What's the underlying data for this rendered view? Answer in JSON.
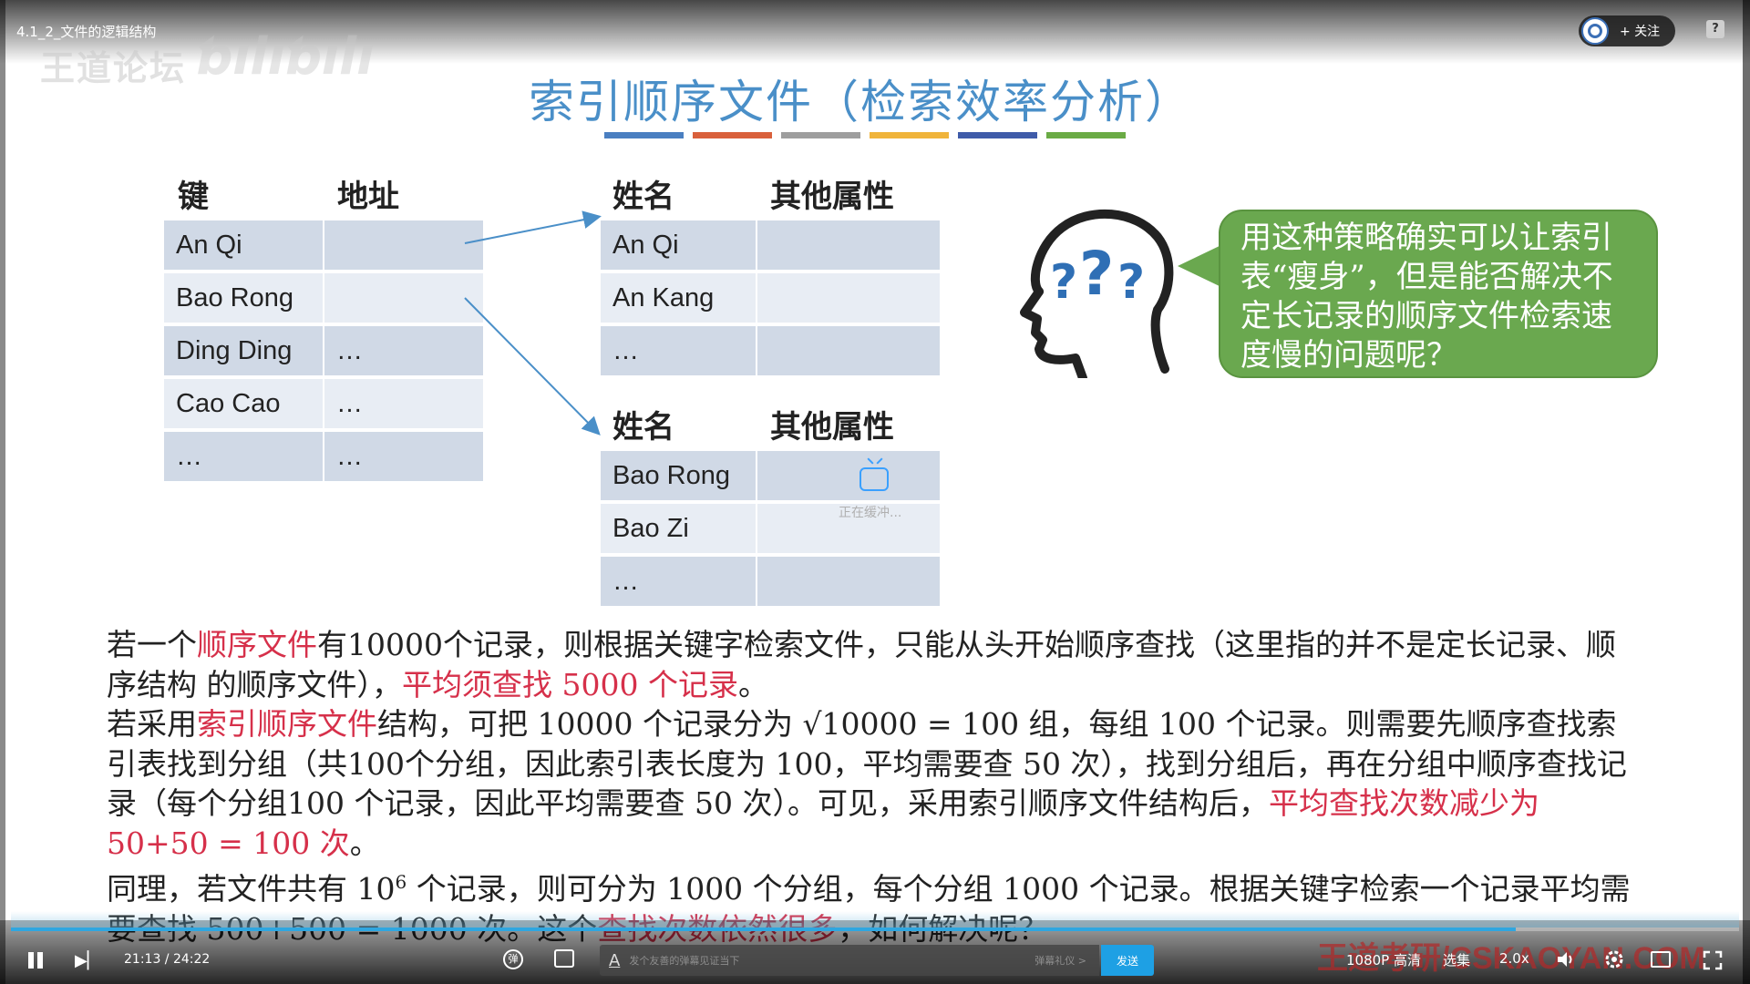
{
  "player": {
    "video_title": "4.1_2_文件的逻辑结构",
    "follow_label": "+ 关注",
    "time_display": "21:13 / 24:22",
    "progress_fraction": 0.8707,
    "danmaku_placeholder": "发个友善的弹幕见证当下",
    "danmaku_etiquette": "弹幕礼仪 >",
    "send_label": "发送",
    "quality_label": "1080P 高清",
    "episodes_label": "选集",
    "speed_label": "2.0x",
    "loading_text": "正在缓冲...",
    "help_label": "?"
  },
  "watermark": {
    "top_left": "王道论坛",
    "bottom_right": "王道考研/CSKAOYAN.COM"
  },
  "slide": {
    "title": "索引顺序文件（检索效率分析）",
    "title_bar_colors": [
      "#4a7fc1",
      "#d9603b",
      "#9e9e9e",
      "#f0b43a",
      "#3f5ba9",
      "#6aab45"
    ],
    "index_table": {
      "headers": [
        "键",
        "地址"
      ],
      "rows": [
        [
          "An Qi",
          ""
        ],
        [
          "Bao Rong",
          ""
        ],
        [
          "Ding Ding",
          "…"
        ],
        [
          "Cao Cao",
          "…"
        ],
        [
          "…",
          "…"
        ]
      ]
    },
    "group_table_1": {
      "headers": [
        "姓名",
        "其他属性"
      ],
      "rows": [
        [
          "An Qi",
          ""
        ],
        [
          "An Kang",
          ""
        ],
        [
          "…",
          ""
        ]
      ]
    },
    "group_table_2": {
      "headers": [
        "姓名",
        "其他属性"
      ],
      "rows": [
        [
          "Bao Rong",
          ""
        ],
        [
          "Bao Zi",
          ""
        ],
        [
          "…",
          ""
        ]
      ]
    },
    "bubble_text": "用这种策略确实可以让索引表“瘦身”，但是能否解决不定长记录的顺序文件检索速度慢的问题呢？",
    "paragraph_1": [
      {
        "t": "若一个",
        "red": false
      },
      {
        "t": "顺序文件",
        "red": true
      },
      {
        "t": "有10000个记录，则根据关键字检索文件，只能从头开始顺序查找（这里指的并不是定长记录、顺序结构 的顺序文件），",
        "red": false
      },
      {
        "t": "平均须查找 5000 个记录",
        "red": true
      },
      {
        "t": "。",
        "red": false
      }
    ],
    "paragraph_2": [
      {
        "t": "若采用",
        "red": false
      },
      {
        "t": "索引顺序文件",
        "red": true
      },
      {
        "t": "结构，可把 10000 个记录分为 √10000 = 100 组，每组 100 个记录。则需要先顺序查找索引表找到分组（共100个分组，因此索引表长度为 100，平均需要查 50 次），找到分组后，再在分组中顺序查找记录（每个分组100 个记录，因此平均需要查 50 次）。可见，采用索引顺序文件结构后，",
        "red": false
      },
      {
        "t": "平均查找次数减少为 50+50 = 100 次",
        "red": true
      },
      {
        "t": "。",
        "red": false
      }
    ],
    "paragraph_3": [
      {
        "t": "同理，若文件共有 10",
        "red": false
      },
      {
        "t": "6",
        "red": false,
        "sup": true
      },
      {
        "t": " 个记录，则可分为 1000 个分组，每个分组 1000 个记录。根据关键字检索一个记录平均需要查找 500+500 = 1000 次。这个",
        "red": false
      },
      {
        "t": "查找次数依然很多",
        "red": true
      },
      {
        "t": "，如何解决呢？",
        "red": false
      }
    ]
  }
}
